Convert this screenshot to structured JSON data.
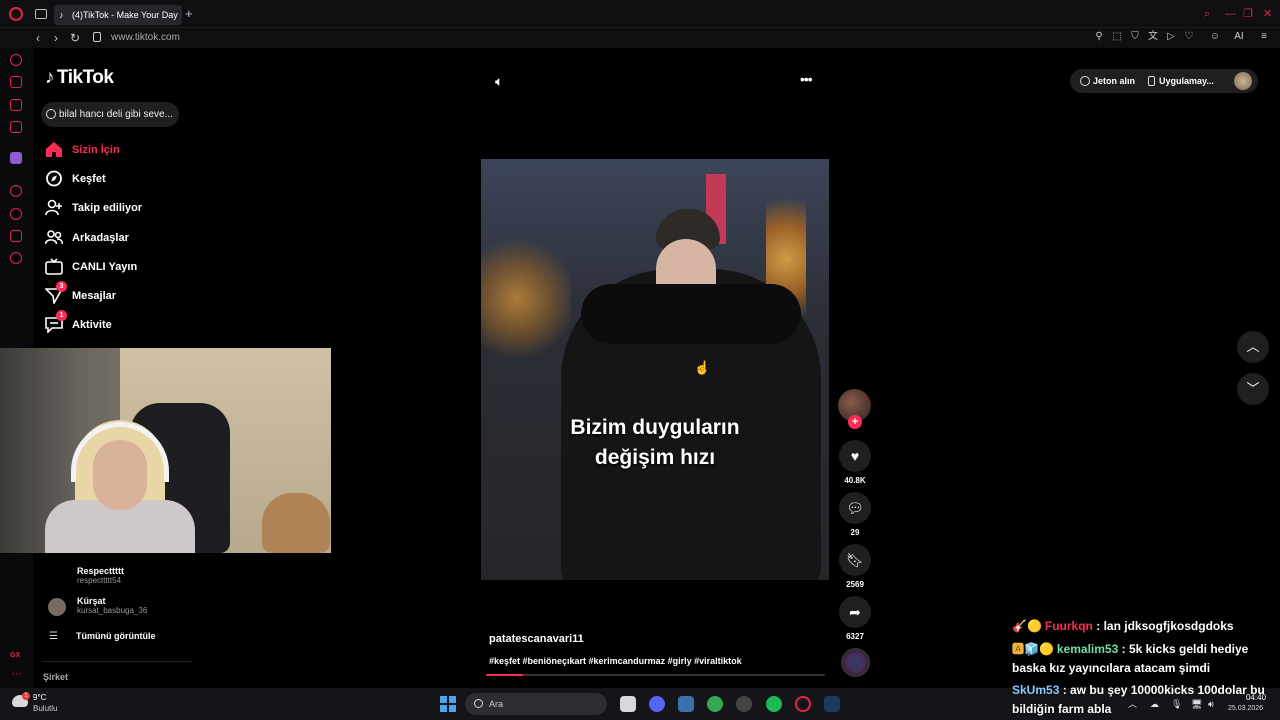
{
  "browser": {
    "tab_title": "(4)TikTok - Make Your Day",
    "new_tab": "+",
    "url": "www.tiktok.com",
    "accent": "#e1254a",
    "addr_ai": "AI"
  },
  "sidebar": {
    "logo": "TikTok",
    "search_value": "bilal hancı deli gibi seve...",
    "items": [
      {
        "label": "Sizin İçin",
        "icon": "home-icon",
        "active": true
      },
      {
        "label": "Keşfet",
        "icon": "compass-icon"
      },
      {
        "label": "Takip ediliyor",
        "icon": "following-icon"
      },
      {
        "label": "Arkadaşlar",
        "icon": "friends-icon"
      },
      {
        "label": "CANLI Yayın",
        "icon": "live-icon"
      },
      {
        "label": "Mesajlar",
        "icon": "messages-icon",
        "badge": "3"
      },
      {
        "label": "Aktivite",
        "icon": "activity-icon",
        "badge": "1"
      }
    ],
    "accounts": [
      {
        "name": "Respecttttt",
        "handle": "respecttttt54"
      },
      {
        "name": "Kürşat",
        "handle": "kursat_basbuga_36"
      }
    ],
    "view_all": "Tümünü görüntüle",
    "company": "Şirket"
  },
  "video": {
    "caption_line1": "Bizim duyguların",
    "caption_line2": "değişim hızı",
    "author": "patatescanavari11",
    "hashtags": "#keşfet #beniöneçıkart #kerimcandurmaz #girly #viraltiktok",
    "progress": 0.11,
    "likes": "40.8K",
    "comments": "29",
    "saves": "2569",
    "shares": "6327"
  },
  "topright": {
    "coins": "Jeton alın",
    "app": "Uygulamay..."
  },
  "chat": [
    {
      "badges": "🎸🟡",
      "user": "Fuurkqn",
      "text": ": lan jdksogfjkosdgdoks",
      "color": "#fe2c55"
    },
    {
      "badges": "🅰🧊🟡",
      "user": "kemalim53",
      "text": ": 5k kicks geldi hediye baska kız yayıncılara atacam şimdi",
      "color": "#6ee0a6"
    },
    {
      "badges": "",
      "user": "SkUm53",
      "text": ": aw bu şey 10000kicks 100dolar bu bildiğin farm abla",
      "color": "#8cc8ff"
    }
  ],
  "taskbar": {
    "temp": "9°C",
    "weather": "Bulutlu",
    "weather_badge": "1",
    "search": "Ara",
    "time": "04:40",
    "date": "25.03.2026"
  }
}
